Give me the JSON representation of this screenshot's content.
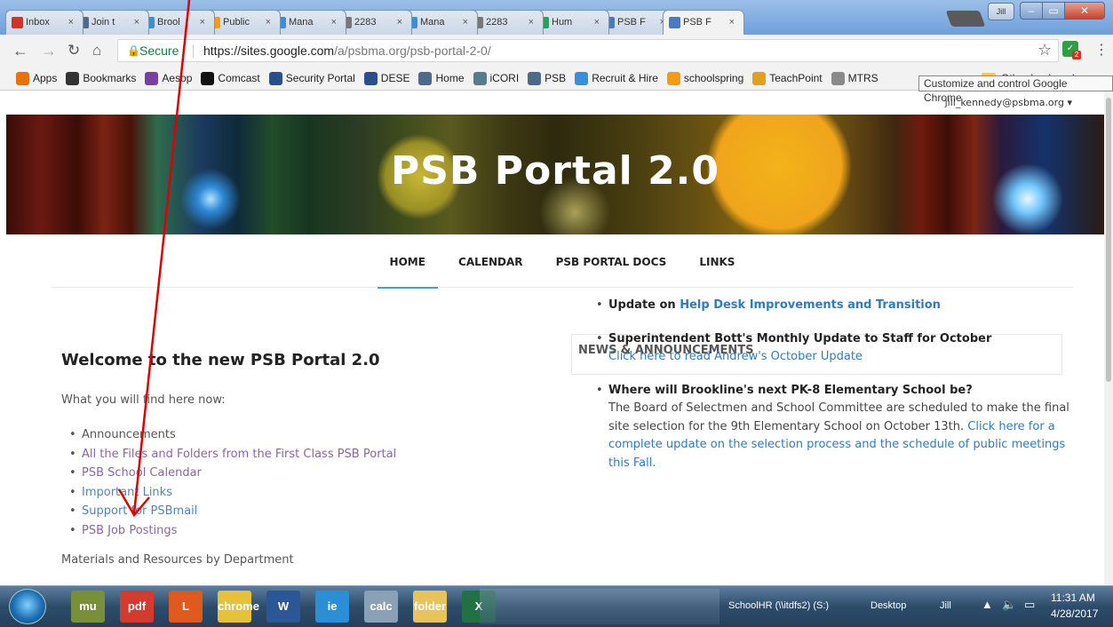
{
  "browser": {
    "tabs": [
      {
        "label": "Inbox",
        "icon": "gmail-icon",
        "color": "#d93025"
      },
      {
        "label": "Join t",
        "icon": "globe-icon",
        "color": "#4d6a8c"
      },
      {
        "label": "Brool",
        "icon": "recruit-icon",
        "color": "#3a8fd8"
      },
      {
        "label": "Public",
        "icon": "schoolspring-icon",
        "color": "#f39c12"
      },
      {
        "label": "Mana",
        "icon": "recruit-icon",
        "color": "#3a8fd8"
      },
      {
        "label": "2283",
        "icon": "document-icon",
        "color": "#777777"
      },
      {
        "label": "Mana",
        "icon": "recruit-icon",
        "color": "#3a8fd8"
      },
      {
        "label": "2283",
        "icon": "document-icon",
        "color": "#777777"
      },
      {
        "label": "Hum",
        "icon": "drive-icon",
        "color": "#1fa463"
      },
      {
        "label": "PSB F",
        "icon": "sites-icon",
        "color": "#4a7bbf"
      },
      {
        "label": "PSB F",
        "icon": "sites-icon",
        "color": "#4a7bbf",
        "active": true
      }
    ],
    "close_glyph": "×",
    "secure_label": "Secure",
    "url_host": "https://sites.google.com",
    "url_path": "/a/psbma.org/psb-portal-2-0/",
    "tooltip": "Customize and control Google Chrome",
    "bookmarks": [
      {
        "label": "Apps",
        "icon": "apps-grid-icon",
        "color": "#e8710a"
      },
      {
        "label": "Bookmarks",
        "icon": "star-icon",
        "color": "#333333"
      },
      {
        "label": "Aesop",
        "icon": "aesop-icon",
        "color": "#7b3fa0"
      },
      {
        "label": "Comcast",
        "icon": "comcast-icon",
        "color": "#111111"
      },
      {
        "label": "Security Portal",
        "icon": "shield-icon",
        "color": "#2a4f8f"
      },
      {
        "label": "DESE",
        "icon": "shield-icon",
        "color": "#2a4f8f"
      },
      {
        "label": "Home",
        "icon": "globe-icon",
        "color": "#4d6a8c"
      },
      {
        "label": "iCORI",
        "icon": "icori-icon",
        "color": "#5a7b8c"
      },
      {
        "label": "PSB",
        "icon": "globe-icon",
        "color": "#4d6a8c"
      },
      {
        "label": "Recruit & Hire",
        "icon": "recruit-icon",
        "color": "#3a8fd8"
      },
      {
        "label": "schoolspring",
        "icon": "schoolspring-icon",
        "color": "#f39c12"
      },
      {
        "label": "TeachPoint",
        "icon": "teachpoint-icon",
        "color": "#e0a020"
      },
      {
        "label": "MTRS",
        "icon": "mtrs-icon",
        "color": "#8a8a8a"
      }
    ],
    "bookmarks_overflow": "»",
    "other_bookmarks": "Other bookmarks"
  },
  "page": {
    "account": "jill_kennedy@psbma.org ▾",
    "banner_title": "PSB Portal 2.0",
    "nav": [
      "HOME",
      "CALENDAR",
      "PSB PORTAL DOCS",
      "LINKS"
    ],
    "welcome_title": "Welcome to the new PSB Portal 2.0",
    "find_intro": "What you will find here now:",
    "find_items": [
      {
        "text": "Announcements",
        "link": false
      },
      {
        "text": "All the Files and Folders from the First Class PSB Portal",
        "link": true
      },
      {
        "text": "PSB School Calendar",
        "link": true
      },
      {
        "text": "Important Links",
        "link": true,
        "blue": true
      },
      {
        "text": "Support for PSBmail",
        "link": true,
        "blue": true
      },
      {
        "text": "PSB Job Postings",
        "link": true
      }
    ],
    "materials": "Materials and Resources by Department",
    "news_heading": "NEWS & ANNOUNCEMENTS",
    "news": {
      "item1_prefix": "Update on ",
      "item1_link": "Help Desk Improvements and Transition",
      "item2_title": "Superintendent Bott's Monthly Update to Staff for October",
      "item2_link": "Click here to read Andrew's October Update",
      "item3_title": "Where will Brookline's next PK-8 Elementary School be?",
      "item3_body": "The Board of Selectmen and School Committee are scheduled to make the final site selection for the 9th Elementary School on October 13th. ",
      "item3_link": "Click here for a complete update on the selection process and the schedule of public meetings this Fall."
    }
  },
  "taskbar": {
    "apps": [
      {
        "name": "mu",
        "color": "#7a8f3a"
      },
      {
        "name": "pdf",
        "color": "#d23b2e"
      },
      {
        "name": "L",
        "color": "#e05a1e"
      },
      {
        "name": "chrome",
        "color": "#e8c13a"
      },
      {
        "name": "W",
        "color": "#2b5797"
      },
      {
        "name": "ie",
        "color": "#2a8fd6"
      },
      {
        "name": "calc",
        "color": "#8aa0b5"
      },
      {
        "name": "folder",
        "color": "#e8c35a"
      },
      {
        "name": "X",
        "color": "#207245"
      }
    ],
    "toolbar_schoolhr": "SchoolHR (\\\\itdfs2) (S:)",
    "toolbar_desktop": "Desktop",
    "toolbar_jill": "Jill",
    "time": "11:31 AM",
    "date": "4/28/2017"
  }
}
